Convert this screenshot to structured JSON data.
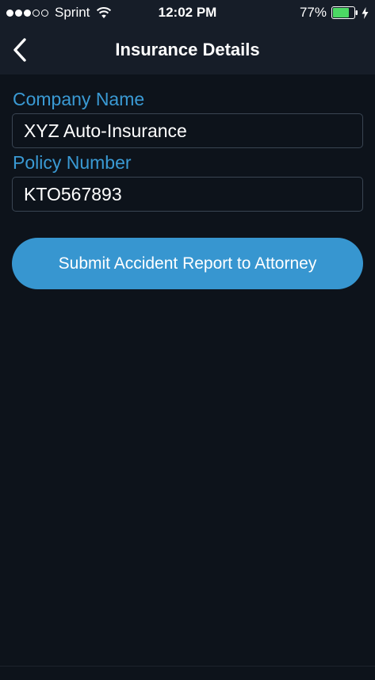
{
  "status_bar": {
    "carrier": "Sprint",
    "time": "12:02 PM",
    "battery_percent": "77%",
    "battery_level": 0.77,
    "signal_bars": 3,
    "signal_total": 5
  },
  "nav": {
    "title": "Insurance Details",
    "back_icon": "chevron-left-icon"
  },
  "form": {
    "company_label": "Company Name",
    "company_value": "XYZ Auto-Insurance",
    "policy_label": "Policy Number",
    "policy_value": "KTO567893",
    "submit_label": "Submit Accident Report to Attorney"
  },
  "colors": {
    "background": "#0d131b",
    "bar": "#161d28",
    "accent": "#3a9ad4",
    "button": "#3796d0",
    "battery_fill": "#4cd964"
  }
}
